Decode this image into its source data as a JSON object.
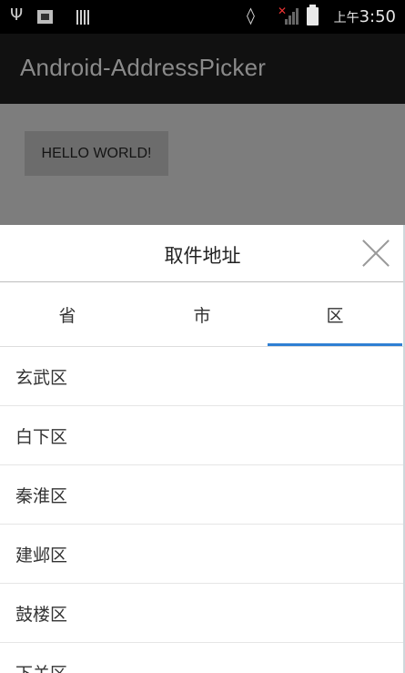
{
  "status_bar": {
    "time_prefix": "上午",
    "time": "3:50",
    "icons": [
      "usb-icon",
      "image-icon",
      "barcode-icon",
      "vibrate-icon",
      "no-signal-icon",
      "battery-icon"
    ]
  },
  "app_bar": {
    "title": "Android-AddressPicker"
  },
  "content": {
    "hello_button_label": "HELLO WORLD!"
  },
  "picker": {
    "title": "取件地址",
    "close_icon": "close-icon",
    "tabs": [
      {
        "label": "省",
        "selected": false
      },
      {
        "label": "市",
        "selected": false
      },
      {
        "label": "区",
        "selected": true
      }
    ],
    "items": [
      "玄武区",
      "白下区",
      "秦淮区",
      "建邺区",
      "鼓楼区",
      "下关区"
    ]
  },
  "colors": {
    "accent": "#2f7fd3",
    "app_bar": "#111111",
    "dim_overlay": "#7d7d7d"
  }
}
